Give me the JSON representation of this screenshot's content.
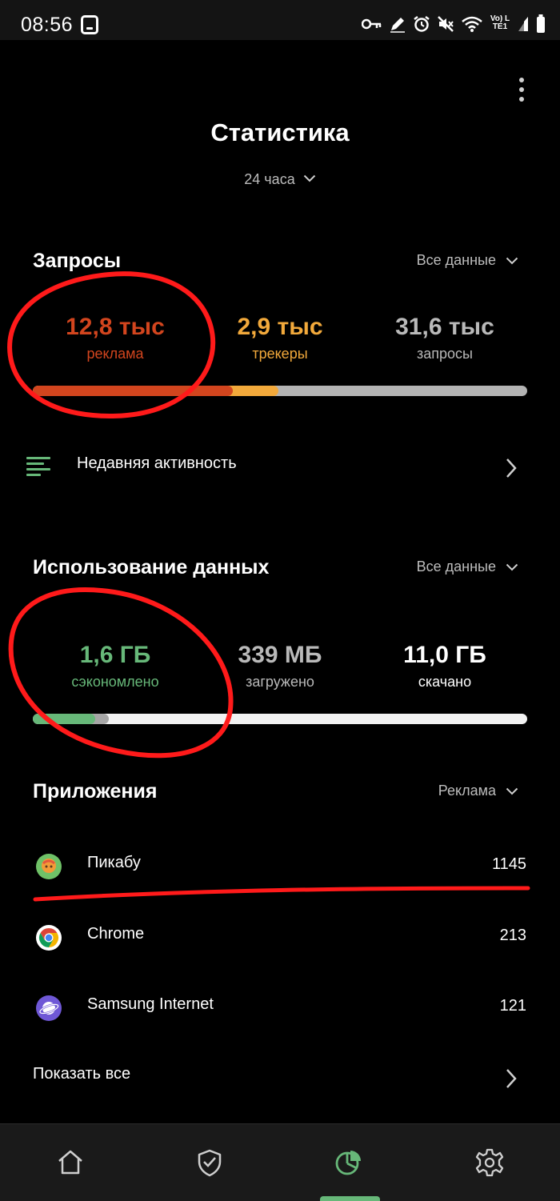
{
  "status_bar": {
    "time": "08:56",
    "network_label": "Vo) LTE1"
  },
  "header": {
    "title": "Статистика",
    "period": "24 часа"
  },
  "requests": {
    "title": "Запросы",
    "filter": "Все данные",
    "ads_value": "12,8 тыс",
    "ads_label": "реклама",
    "trackers_value": "2,9 тыс",
    "trackers_label": "трекеры",
    "total_value": "31,6 тыс",
    "total_label": "запросы",
    "ads_fraction": 0.405,
    "trackers_fraction": 0.092
  },
  "recent_activity": {
    "label": "Недавняя активность"
  },
  "data_usage": {
    "title": "Использование данных",
    "filter": "Все данные",
    "saved_value": "1,6 ГБ",
    "saved_label": "сэкономлено",
    "uploaded_value": "339 МБ",
    "uploaded_label": "загружено",
    "downloaded_value": "11,0 ГБ",
    "downloaded_label": "скачано",
    "saved_fraction": 0.127,
    "uploaded_fraction": 0.027
  },
  "apps": {
    "title": "Приложения",
    "filter": "Реклама",
    "items": [
      {
        "name": "Пикабу",
        "count": "1145",
        "icon": "pikabu-icon"
      },
      {
        "name": "Chrome",
        "count": "213",
        "icon": "chrome-icon"
      },
      {
        "name": "Samsung Internet",
        "count": "121",
        "icon": "samsung-internet-icon"
      }
    ],
    "show_all": "Показать все"
  },
  "colors": {
    "ads": "#d2451e",
    "trackers": "#f2a93b",
    "total": "#b9b9b9",
    "saved": "#67b879",
    "accent": "#67b879",
    "annotation": "#ff1a1a"
  },
  "bottom_nav": {
    "items": [
      "home-icon",
      "shield-check-icon",
      "statistics-icon",
      "settings-icon"
    ],
    "active": "statistics-icon"
  }
}
